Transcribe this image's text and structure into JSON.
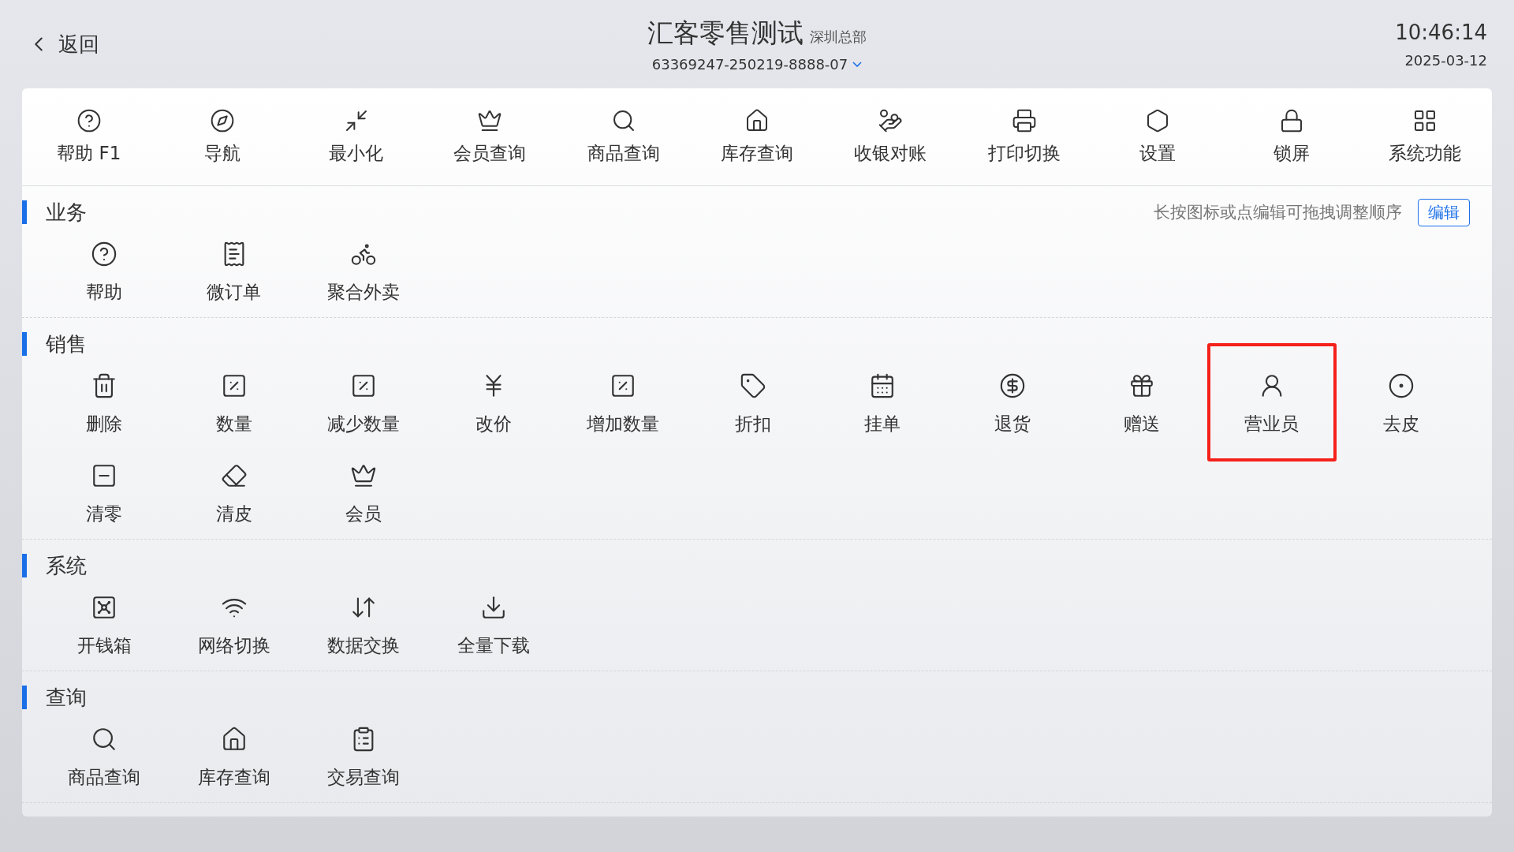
{
  "header": {
    "back": "返回",
    "title": "汇客零售测试",
    "store": "深圳总部",
    "terminal": "63369247-250219-8888-07",
    "time": "10:46:14",
    "date": "2025-03-12"
  },
  "toolbar": [
    "帮助 F1",
    "导航",
    "最小化",
    "会员查询",
    "商品查询",
    "库存查询",
    "收银对账",
    "打印切换",
    "设置",
    "锁屏",
    "系统功能"
  ],
  "hint": "长按图标或点编辑可拖拽调整顺序",
  "edit_button": "编辑",
  "sections": [
    {
      "title": "业务",
      "items": [
        {
          "label": "帮助",
          "highlighted": false
        },
        {
          "label": "微订单",
          "highlighted": false
        },
        {
          "label": "聚合外卖",
          "highlighted": false
        }
      ]
    },
    {
      "title": "销售",
      "items": [
        {
          "label": "删除",
          "highlighted": false
        },
        {
          "label": "数量",
          "highlighted": false
        },
        {
          "label": "减少数量",
          "highlighted": false
        },
        {
          "label": "改价",
          "highlighted": false
        },
        {
          "label": "增加数量",
          "highlighted": false
        },
        {
          "label": "折扣",
          "highlighted": false
        },
        {
          "label": "挂单",
          "highlighted": false
        },
        {
          "label": "退货",
          "highlighted": false
        },
        {
          "label": "赠送",
          "highlighted": false
        },
        {
          "label": "营业员",
          "highlighted": true
        },
        {
          "label": "去皮",
          "highlighted": false
        },
        {
          "label": "清零",
          "highlighted": false
        },
        {
          "label": "清皮",
          "highlighted": false
        },
        {
          "label": "会员",
          "highlighted": false
        }
      ]
    },
    {
      "title": "系统",
      "items": [
        {
          "label": "开钱箱",
          "highlighted": false
        },
        {
          "label": "网络切换",
          "highlighted": false
        },
        {
          "label": "数据交换",
          "highlighted": false
        },
        {
          "label": "全量下载",
          "highlighted": false
        }
      ]
    },
    {
      "title": "查询",
      "items": [
        {
          "label": "商品查询",
          "highlighted": false
        },
        {
          "label": "库存查询",
          "highlighted": false
        },
        {
          "label": "交易查询",
          "highlighted": false
        }
      ]
    }
  ]
}
